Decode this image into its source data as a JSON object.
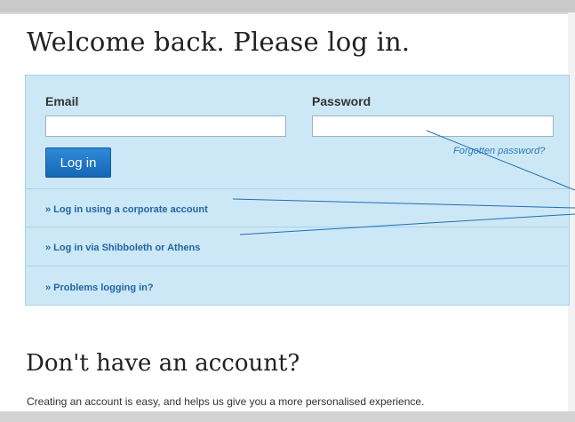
{
  "login": {
    "heading": "Welcome back. Please log in.",
    "email_label": "Email",
    "email_value": "",
    "password_label": "Password",
    "password_value": "",
    "login_button": "Log in",
    "forgot_link": "Forgotten password?",
    "links": [
      "» Log in using a corporate account",
      "» Log in via Shibboleth or Athens",
      "» Problems logging in?"
    ]
  },
  "register": {
    "heading": "Don't have an account?",
    "text": "Creating an account is easy, and helps us give you a more personalised experience."
  },
  "colors": {
    "panel_bg": "#cce8f6",
    "button_bg": "#1a73c4",
    "link": "#2265a5",
    "callout_line": "#1f6fb3"
  }
}
